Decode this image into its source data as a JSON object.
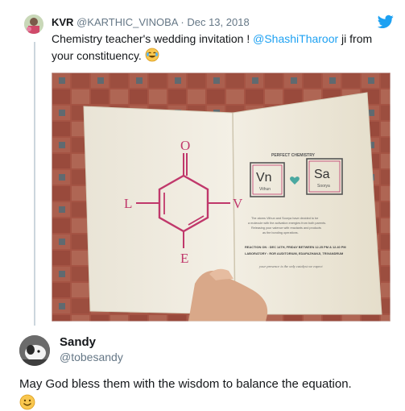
{
  "tweet": {
    "name": "KVR",
    "handle": "@KARTHIC_VINOBA",
    "separator": "·",
    "date": "Dec 13, 2018",
    "text_before": "Chemistry teacher's wedding invitation ! ",
    "mention": "@ShashiTharoor",
    "text_after": " ji from your constituency.",
    "laugh_emoji": "laughing-face-icon"
  },
  "invitation": {
    "letters": {
      "left": "L",
      "top": "O",
      "right": "V",
      "bottom": "E"
    },
    "heading": "PERFECT CHEMISTRY",
    "element1": {
      "symbol": "Vn",
      "name": "Vithun"
    },
    "element2": {
      "symbol": "Sa",
      "name": "Soorya"
    },
    "body_line1": "The atoms Vithun and Soorya have decided to be",
    "body_line2": "a molecule with the activation energies from both parents.",
    "body_line3": "Releasing your valence with reactants and products",
    "body_line4": "as the bonding operations.",
    "reaction": "REACTION ON : DEC 14TH, FRIDAY BETWEEN 12.25 PM & 12.40 PM",
    "laboratory": "LABORATORY : ROR AUDITORIUM, EDAPAZHANJI, TRIVANDRUM",
    "catalyst": "your presence is the only catalyst we expect"
  },
  "reply": {
    "name": "Sandy",
    "handle": "@tobesandy",
    "text": "May God bless them with the wisdom to balance the equation.",
    "emoji": "smiling-face-icon"
  },
  "colors": {
    "accent": "#1da1f2",
    "ring": "#c0386b",
    "paper": "#f3efe4"
  }
}
